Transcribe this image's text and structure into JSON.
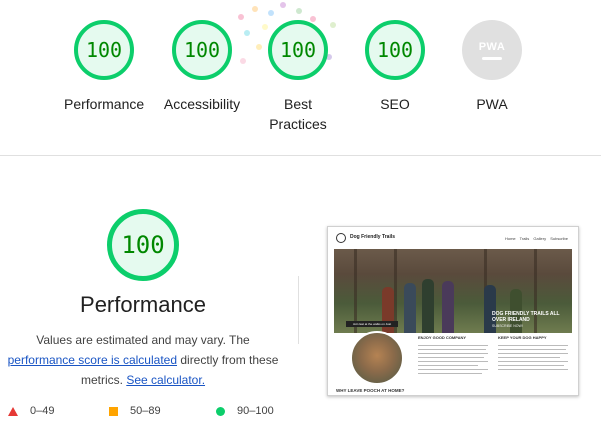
{
  "summary": {
    "gauges": [
      {
        "score": "100",
        "label": "Performance"
      },
      {
        "score": "100",
        "label": "Accessibility"
      },
      {
        "score": "100",
        "label": "Best Practices"
      },
      {
        "score": "100",
        "label": "SEO"
      },
      {
        "pwa_text": "PWA",
        "label": "PWA"
      }
    ]
  },
  "detail": {
    "score": "100",
    "title": "Performance",
    "desc_part1": "Values are estimated and may vary. The",
    "desc_link1": "performance score is calculated",
    "desc_part2": " directly from these metrics. ",
    "desc_link2": "See calculator."
  },
  "legend": [
    {
      "range": "0–49"
    },
    {
      "range": "50–89"
    },
    {
      "range": "90–100"
    }
  ],
  "screenshot": {
    "brand": "Dog Friendly Trails",
    "nav": "Home Trails Gallery Subscribe",
    "hero_title": "DOG FRIENDLY TRAILS ALL OVER IRELAND",
    "hero_sub": "SUBSCRIBE NOW!",
    "caption": "Join last at the walks on Just",
    "col1": "ENJOY GOOD COMPANY",
    "col2": "KEEP YOUR DOG HAPPY",
    "footer": "WHY LEAVE POOCH AT HOME?"
  },
  "colors": {
    "pass": "#0cce6b",
    "average": "#ffa400",
    "fail": "#e53935",
    "link": "#1a55c4"
  }
}
